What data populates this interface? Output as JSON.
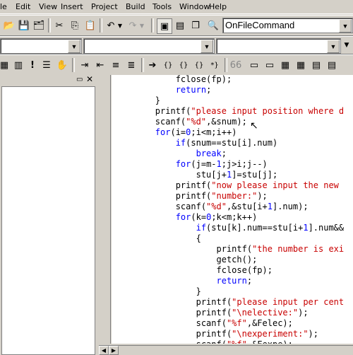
{
  "menu": [
    "le",
    "Edit",
    "View",
    "Insert",
    "Project",
    "Build",
    "Tools",
    "Window",
    "Help"
  ],
  "toolbar": {
    "function_combo": "OnFileCommand"
  },
  "icons": [
    "open-icon",
    "save-icon",
    "save-all-icon",
    "cut-icon",
    "copy-icon",
    "paste-icon",
    "undo-icon",
    "redo-icon",
    "workspace-icon",
    "output-icon",
    "windows-icon",
    "find-icon",
    "bookmark-icon",
    "breakpoint-icon",
    "run-icon",
    "step-icon"
  ],
  "code_lines": [
    [
      {
        "t": "            fclose(fp);",
        "c": ""
      }
    ],
    [
      {
        "t": "            ",
        "c": ""
      },
      {
        "t": "return",
        "c": "kw"
      },
      {
        "t": ";",
        "c": ""
      }
    ],
    [
      {
        "t": "        }",
        "c": ""
      }
    ],
    [
      {
        "t": "        printf(",
        "c": ""
      },
      {
        "t": "\"please input position where d",
        "c": "str"
      }
    ],
    [
      {
        "t": "        scanf(",
        "c": ""
      },
      {
        "t": "\"%d\"",
        "c": "str"
      },
      {
        "t": ",&snum);",
        "c": ""
      }
    ],
    [
      {
        "t": "        ",
        "c": ""
      },
      {
        "t": "for",
        "c": "kw"
      },
      {
        "t": "(i=",
        "c": ""
      },
      {
        "t": "0",
        "c": "kw"
      },
      {
        "t": ";i<m;i++)",
        "c": ""
      }
    ],
    [
      {
        "t": "            ",
        "c": ""
      },
      {
        "t": "if",
        "c": "kw"
      },
      {
        "t": "(snum==stu[i].num)",
        "c": ""
      }
    ],
    [
      {
        "t": "                ",
        "c": ""
      },
      {
        "t": "break",
        "c": "kw"
      },
      {
        "t": ";",
        "c": ""
      }
    ],
    [
      {
        "t": "            ",
        "c": ""
      },
      {
        "t": "for",
        "c": "kw"
      },
      {
        "t": "(j=m-",
        "c": ""
      },
      {
        "t": "1",
        "c": "kw"
      },
      {
        "t": ";j>i;j--)",
        "c": ""
      }
    ],
    [
      {
        "t": "                stu[j+",
        "c": ""
      },
      {
        "t": "1",
        "c": "kw"
      },
      {
        "t": "]=stu[j];",
        "c": ""
      }
    ],
    [
      {
        "t": "            printf(",
        "c": ""
      },
      {
        "t": "\"now please input the new",
        "c": "str"
      }
    ],
    [
      {
        "t": "            printf(",
        "c": ""
      },
      {
        "t": "\"number:\"",
        "c": "str"
      },
      {
        "t": ");",
        "c": ""
      }
    ],
    [
      {
        "t": "            scanf(",
        "c": ""
      },
      {
        "t": "\"%d\"",
        "c": "str"
      },
      {
        "t": ",&stu[i+",
        "c": ""
      },
      {
        "t": "1",
        "c": "kw"
      },
      {
        "t": "].num);",
        "c": ""
      }
    ],
    [
      {
        "t": "            ",
        "c": ""
      },
      {
        "t": "for",
        "c": "kw"
      },
      {
        "t": "(k=",
        "c": ""
      },
      {
        "t": "0",
        "c": "kw"
      },
      {
        "t": ";k<m;k++)",
        "c": ""
      }
    ],
    [
      {
        "t": "                ",
        "c": ""
      },
      {
        "t": "if",
        "c": "kw"
      },
      {
        "t": "(stu[k].num==stu[i+",
        "c": ""
      },
      {
        "t": "1",
        "c": "kw"
      },
      {
        "t": "].num&&",
        "c": ""
      }
    ],
    [
      {
        "t": "                {",
        "c": ""
      }
    ],
    [
      {
        "t": "                    printf(",
        "c": ""
      },
      {
        "t": "\"the number is exi",
        "c": "str"
      }
    ],
    [
      {
        "t": "                    getch();",
        "c": ""
      }
    ],
    [
      {
        "t": "                    fclose(fp);",
        "c": ""
      }
    ],
    [
      {
        "t": "                    ",
        "c": ""
      },
      {
        "t": "return",
        "c": "kw"
      },
      {
        "t": ";",
        "c": ""
      }
    ],
    [
      {
        "t": "                }",
        "c": ""
      }
    ],
    [
      {
        "t": "                printf(",
        "c": ""
      },
      {
        "t": "\"please input per cent",
        "c": "str"
      }
    ],
    [
      {
        "t": "                printf(",
        "c": ""
      },
      {
        "t": "\"\\nelective:\"",
        "c": "str"
      },
      {
        "t": ");",
        "c": ""
      }
    ],
    [
      {
        "t": "                scanf(",
        "c": ""
      },
      {
        "t": "\"%f\"",
        "c": "str"
      },
      {
        "t": ",&Felec);",
        "c": ""
      }
    ],
    [
      {
        "t": "                printf(",
        "c": ""
      },
      {
        "t": "\"\\nexperiment:\"",
        "c": "str"
      },
      {
        "t": ");",
        "c": ""
      }
    ],
    [
      {
        "t": "                scanf(",
        "c": ""
      },
      {
        "t": "\"%f\"",
        "c": "str"
      },
      {
        "t": ",&Fexpe);",
        "c": ""
      }
    ]
  ]
}
